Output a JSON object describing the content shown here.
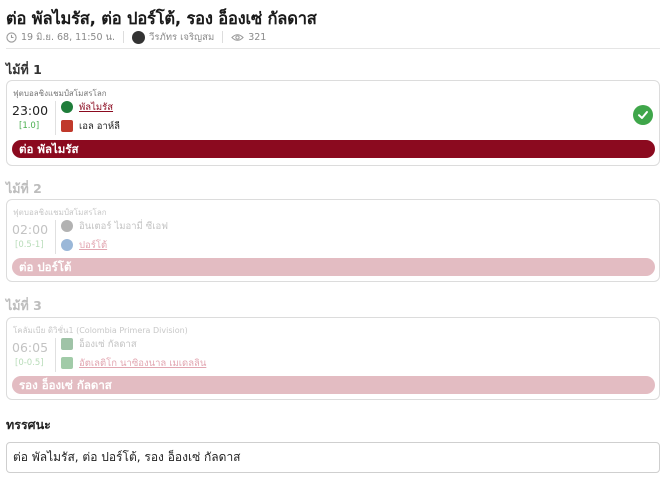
{
  "article": {
    "title": "ต่อ พัลไมรัส, ต่อ ปอร์โต้, รอง อ็องเซ่ กัลดาส",
    "date": "19 มิ.ย. 68, 11:50 น.",
    "author": "วีรภัทร เจริญสม",
    "views": "321"
  },
  "picks": [
    {
      "label": "ไม้ที่ 1",
      "league": "ฟุตบอลชิงแชมป์สโมสรโลก",
      "time": "23:00",
      "handicap": "[1.0]",
      "team1": "พัลไมรัส",
      "team2": "เอล อาห์ลี",
      "team1_logo_color": "#1e7d3a",
      "team2_logo_color": "#c0392b",
      "picked_team": 1,
      "result_text": "ต่อ พัลไมรัส",
      "status": "win"
    },
    {
      "label": "ไม้ที่ 2",
      "league": "ฟุตบอลชิงแชมป์สโมสรโลก",
      "time": "02:00",
      "handicap": "[0.5-1]",
      "team1": "อินเตอร์ ไมอามี่ ซีเอฟ",
      "team2": "ปอร์โต้",
      "team1_logo_color": "#555555",
      "team2_logo_color": "#1f5fa8",
      "picked_team": 2,
      "result_text": "ต่อ ปอร์โต้",
      "status": "pending"
    },
    {
      "label": "ไม้ที่ 3",
      "league": "โคลัมเบีย ดิวิชั่น1 (Colombia Primera Division)",
      "time": "06:05",
      "handicap": "[0-0.5]",
      "team1": "อ็องเซ่ กัลดาส",
      "team2": "อัตเลติโก นาซิองนาล เมเดลลิน",
      "team1_logo_color": "#2a7a3b",
      "team2_logo_color": "#2e8b3e",
      "picked_team": 2,
      "result_text": "รอง อ็องเซ่ กัลดาส",
      "status": "pending"
    }
  ],
  "summary": {
    "label": "ทรรศนะ",
    "text": "ต่อ พัลไมรัส, ต่อ ปอร์โต้, รอง อ็องเซ่ กัลดาส"
  },
  "colors": {
    "accent": "#8b0a1f",
    "accent_faded": "#e3bcc2",
    "win": "#3fa64a"
  }
}
